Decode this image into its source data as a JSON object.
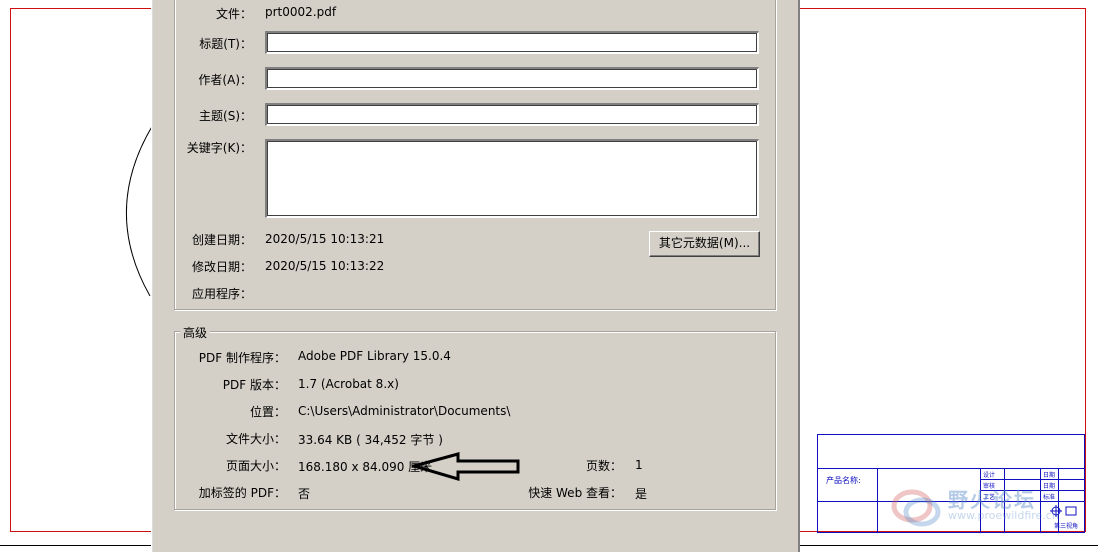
{
  "description_section": {
    "file_label": "文件：",
    "file_value": "prt0002.pdf",
    "title_label": "标题(T)：",
    "title_value": "",
    "author_label": "作者(A)：",
    "author_value": "",
    "subject_label": "主题(S)：",
    "subject_value": "",
    "keywords_label": "关键字(K)：",
    "keywords_value": "",
    "created_label": "创建日期：",
    "created_value": "2020/5/15 10:13:21",
    "modified_label": "修改日期：",
    "modified_value": "2020/5/15 10:13:22",
    "application_label": "应用程序：",
    "application_value": "",
    "more_metadata_button": "其它元数据(M)..."
  },
  "advanced_section": {
    "title": "高级",
    "producer_label": "PDF 制作程序：",
    "producer_value": "Adobe PDF Library 15.0.4",
    "version_label": "PDF 版本：",
    "version_value": "1.7 (Acrobat 8.x)",
    "location_label": "位置：",
    "location_value": "C:\\Users\\Administrator\\Documents\\",
    "file_size_label": "文件大小：",
    "file_size_value": "33.64 KB ( 34,452 字节 )",
    "page_size_label": "页面大小：",
    "page_size_value": "168.180 x 84.090 厘米",
    "page_count_label": "页数：",
    "page_count_value": "1",
    "tagged_label": "加标签的 PDF：",
    "tagged_value": "否",
    "fast_web_label": "快速 Web 查看：",
    "fast_web_value": "是"
  },
  "background_drawing": {
    "product_name_label": "产品名称:",
    "tb_design": "设计",
    "tb_review": "审核",
    "tb_craft": "工艺",
    "tb_standard": "标准",
    "tb_date1": "日期",
    "tb_date2": "日期",
    "tb_page": "第 页",
    "tb_sheet": "第三视角",
    "watermark_text": "野火论坛",
    "watermark_url": "www.proewildfire.cn"
  },
  "colors": {
    "dialog_bg": "#d4d0c8",
    "frame_red": "#d01010",
    "title_block_blue": "#1010c0"
  }
}
